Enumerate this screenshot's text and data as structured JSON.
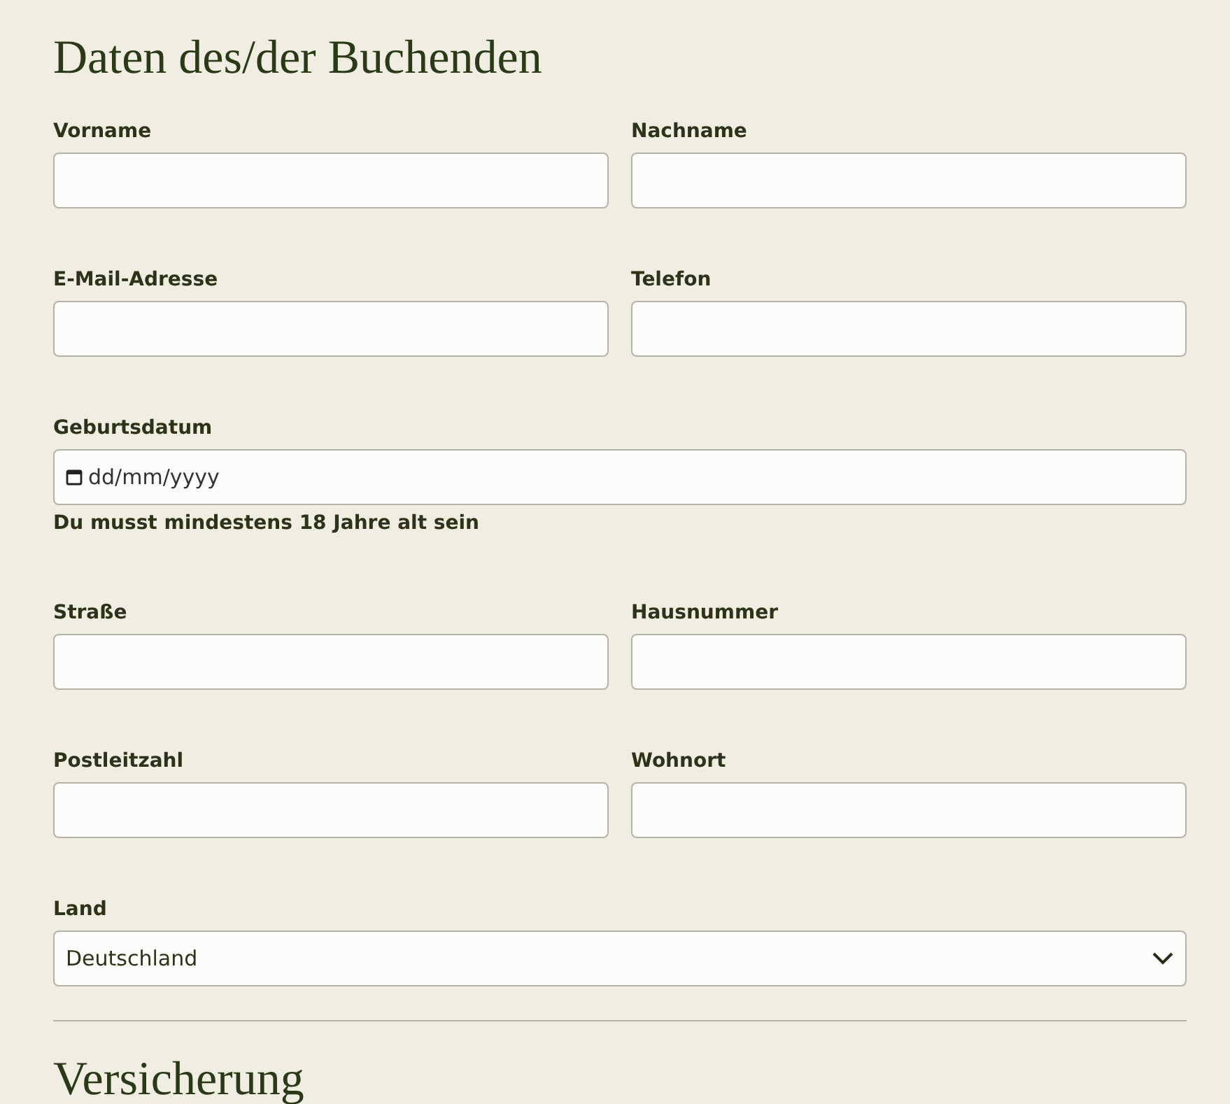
{
  "heading": "Daten des/der Buchenden",
  "rows": [
    {
      "fields": [
        {
          "kind": "text",
          "label": "Vorname"
        },
        {
          "kind": "text",
          "label": "Nachname"
        }
      ]
    },
    {
      "fields": [
        {
          "kind": "text",
          "label": "E-Mail-Adresse"
        },
        {
          "kind": "text",
          "label": "Telefon"
        }
      ]
    },
    {
      "fields": [
        {
          "kind": "date",
          "label": "Geburtsdatum",
          "placeholder": "dd/mm/yyyy",
          "hint": "Du musst mindestens 18 Jahre alt sein"
        }
      ]
    },
    {
      "fields": [
        {
          "kind": "text",
          "label": "Straße"
        },
        {
          "kind": "text",
          "label": "Hausnummer"
        }
      ]
    },
    {
      "fields": [
        {
          "kind": "text",
          "label": "Postleitzahl"
        },
        {
          "kind": "text",
          "label": "Wohnort"
        }
      ]
    },
    {
      "fields": [
        {
          "kind": "select",
          "label": "Land",
          "value": "Deutschland"
        }
      ]
    }
  ],
  "next_heading": "Versicherung"
}
